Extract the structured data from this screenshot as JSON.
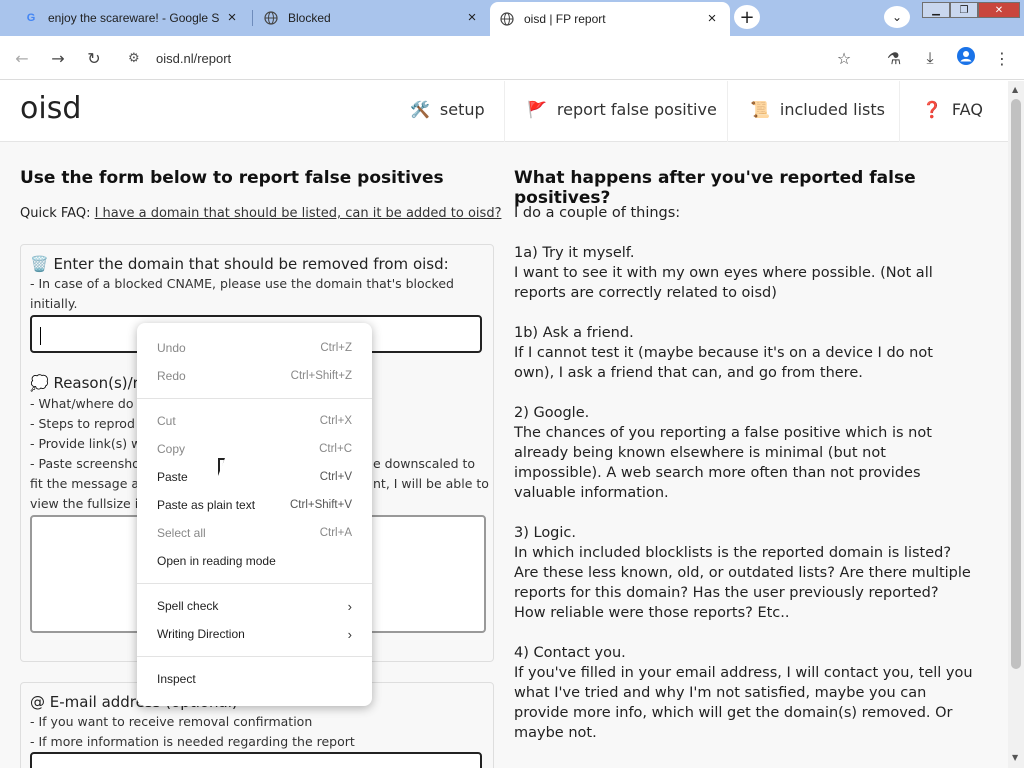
{
  "browser": {
    "tabs": [
      {
        "title": "enjoy the scareware! - Google S",
        "favicon": "G"
      },
      {
        "title": "Blocked",
        "favicon": "globe"
      },
      {
        "title": "oisd | FP report",
        "favicon": "globe"
      }
    ],
    "url": "oisd.nl/report"
  },
  "site": {
    "logo": "oisd",
    "nav": [
      {
        "icon": "🛠️",
        "label": "setup"
      },
      {
        "icon": "🚩",
        "label": "report false positive"
      },
      {
        "icon": "📜",
        "label": "included lists"
      },
      {
        "icon": "❓",
        "label": "FAQ"
      }
    ]
  },
  "form": {
    "heading": "Use the form below to report false positives",
    "faq_prefix": "Quick FAQ: ",
    "faq_link": "I have a domain that should be listed, can it be added to oisd?",
    "domain_title": "🗑️ Enter the domain that should be removed from oisd:",
    "domain_hint_1": "- In case of a blocked CNAME, please use the domain that's blocked",
    "domain_hint_2": "initially.",
    "reason_title": "💭 Reason(s)/r",
    "reason_lines": [
      "- What/where do",
      "- Steps to reprod",
      "- Provide link(s) w",
      "- Paste screensho",
      "fit the message a",
      "view the fullsize i"
    ],
    "reason_right_1": "e downscaled to",
    "reason_right_2": "nt, I will be able to",
    "email_title": "@ E-mail address (optional)",
    "email_hint_1": "- If you want to receive removal confirmation",
    "email_hint_2": "- If more information is needed regarding the report"
  },
  "info": {
    "heading": "What happens after you've reported false positives?",
    "lines": [
      "I do a couple of things:",
      "",
      "1a) Try it myself.",
      "I want to see it with my own eyes where possible. (Not all",
      "reports are correctly related to oisd)",
      "",
      "1b) Ask a friend.",
      "If I cannot test it (maybe because it's on a device I do not",
      "own), I ask a friend that can, and go from there.",
      "",
      "2) Google.",
      "The chances of you reporting a false positive which is not",
      "already being known elsewhere is minimal (but not",
      "impossible). A web search more often than not provides",
      "valuable information.",
      "",
      "3) Logic.",
      "In which included blocklists is the reported domain is listed?",
      "Are these less known, old, or outdated lists? Are there multiple",
      "reports for this domain? Has the user previously reported?",
      "How reliable were those reports? Etc..",
      "",
      "4) Contact you.",
      "If you've filled in your email address, I will contact you, tell you",
      "what I've tried and why I'm not satisfied, maybe you can",
      "provide more info, which will get the domain(s) removed. Or",
      "maybe not."
    ]
  },
  "context_menu": {
    "items": [
      {
        "label": "Undo",
        "shortcut": "Ctrl+Z",
        "disabled": true
      },
      {
        "label": "Redo",
        "shortcut": "Ctrl+Shift+Z",
        "disabled": true
      },
      {
        "label": "Cut",
        "shortcut": "Ctrl+X",
        "disabled": true
      },
      {
        "label": "Copy",
        "shortcut": "Ctrl+C",
        "disabled": true
      },
      {
        "label": "Paste",
        "shortcut": "Ctrl+V",
        "disabled": false
      },
      {
        "label": "Paste as plain text",
        "shortcut": "Ctrl+Shift+V",
        "disabled": false
      },
      {
        "label": "Select all",
        "shortcut": "Ctrl+A",
        "disabled": true
      },
      {
        "label": "Open in reading mode",
        "shortcut": "",
        "disabled": false
      },
      {
        "label": "Spell check",
        "shortcut": "",
        "disabled": false
      },
      {
        "label": "Writing Direction",
        "shortcut": "",
        "disabled": false
      },
      {
        "label": "Inspect",
        "shortcut": "",
        "disabled": false
      }
    ]
  },
  "colors": {
    "tabstrip": "#a9c4ec",
    "page_bg": "#f8f8f8"
  }
}
